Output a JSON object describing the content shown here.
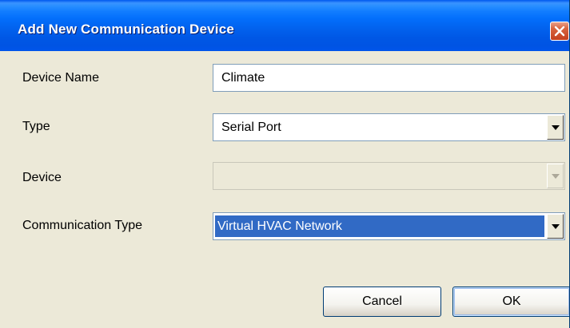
{
  "window": {
    "title": "Add New Communication Device"
  },
  "form": {
    "device_name": {
      "label": "Device Name",
      "value": "Climate"
    },
    "type": {
      "label": "Type",
      "value": "Serial Port"
    },
    "device": {
      "label": "Device",
      "value": ""
    },
    "communication_type": {
      "label": "Communication Type",
      "value": "Virtual HVAC Network"
    }
  },
  "buttons": {
    "cancel": "Cancel",
    "ok": "OK"
  },
  "icons": {
    "close": "close-icon",
    "dropdown": "chevron-down-icon"
  },
  "colors": {
    "titlebar": "#0054e3",
    "dialog_background": "#ece9d8",
    "selection": "#316ac5",
    "close_button": "#d8643f"
  }
}
